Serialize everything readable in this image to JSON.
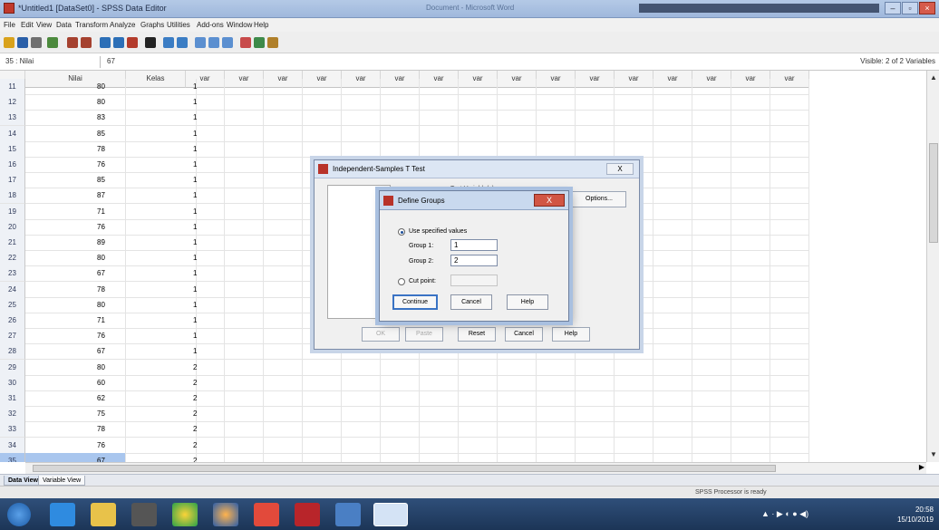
{
  "window": {
    "title": "*Untitled1 [DataSet0] - SPSS Data Editor",
    "center_text": "Document - Microsoft Word"
  },
  "menu": [
    "File",
    "Edit",
    "View",
    "Data",
    "Transform",
    "Analyze",
    "Graphs",
    "Utilities",
    "Add-ons",
    "Window",
    "Help"
  ],
  "cell_editor": {
    "cell_ref": "35 : Nilai",
    "value": "67",
    "visible_vars": "Visible: 2 of 2 Variables"
  },
  "grid": {
    "columns": [
      "Nilai",
      "Kelas",
      "var",
      "var",
      "var",
      "var",
      "var",
      "var",
      "var",
      "var",
      "var",
      "var",
      "var",
      "var",
      "var",
      "var",
      "var",
      "var"
    ],
    "rows": [
      {
        "n": "11",
        "nilai": "80",
        "kelas": "1"
      },
      {
        "n": "12",
        "nilai": "80",
        "kelas": "1"
      },
      {
        "n": "13",
        "nilai": "83",
        "kelas": "1"
      },
      {
        "n": "14",
        "nilai": "85",
        "kelas": "1"
      },
      {
        "n": "15",
        "nilai": "78",
        "kelas": "1"
      },
      {
        "n": "16",
        "nilai": "76",
        "kelas": "1"
      },
      {
        "n": "17",
        "nilai": "85",
        "kelas": "1"
      },
      {
        "n": "18",
        "nilai": "87",
        "kelas": "1"
      },
      {
        "n": "19",
        "nilai": "71",
        "kelas": "1"
      },
      {
        "n": "20",
        "nilai": "76",
        "kelas": "1"
      },
      {
        "n": "21",
        "nilai": "89",
        "kelas": "1"
      },
      {
        "n": "22",
        "nilai": "80",
        "kelas": "1"
      },
      {
        "n": "23",
        "nilai": "67",
        "kelas": "1"
      },
      {
        "n": "24",
        "nilai": "78",
        "kelas": "1"
      },
      {
        "n": "25",
        "nilai": "80",
        "kelas": "1"
      },
      {
        "n": "26",
        "nilai": "71",
        "kelas": "1"
      },
      {
        "n": "27",
        "nilai": "76",
        "kelas": "1"
      },
      {
        "n": "28",
        "nilai": "67",
        "kelas": "1"
      },
      {
        "n": "29",
        "nilai": "80",
        "kelas": "2"
      },
      {
        "n": "30",
        "nilai": "60",
        "kelas": "2"
      },
      {
        "n": "31",
        "nilai": "62",
        "kelas": "2"
      },
      {
        "n": "32",
        "nilai": "75",
        "kelas": "2"
      },
      {
        "n": "33",
        "nilai": "78",
        "kelas": "2"
      },
      {
        "n": "34",
        "nilai": "76",
        "kelas": "2"
      },
      {
        "n": "35",
        "nilai": "67",
        "kelas": "2"
      }
    ]
  },
  "tabs": {
    "data_view": "Data View",
    "variable_view": "Variable View"
  },
  "status": "SPSS Processor is ready",
  "dialog": {
    "title": "Independent-Samples T Test",
    "close": "X",
    "options": "Options...",
    "test_variables_label": "Test Variable(s):",
    "buttons": {
      "ok": "OK",
      "paste": "Paste",
      "reset": "Reset",
      "cancel": "Cancel",
      "help": "Help"
    }
  },
  "define_groups": {
    "title": "Define Groups",
    "close": "X",
    "use_specified": "Use specified values",
    "group1_label": "Group 1:",
    "group1_value": "1",
    "group2_label": "Group 2:",
    "group2_value": "2",
    "cut_point": "Cut point:",
    "buttons": {
      "continue": "Continue",
      "cancel": "Cancel",
      "help": "Help"
    }
  },
  "taskbar": {
    "time": "20:58",
    "date": "15/10/2019"
  }
}
